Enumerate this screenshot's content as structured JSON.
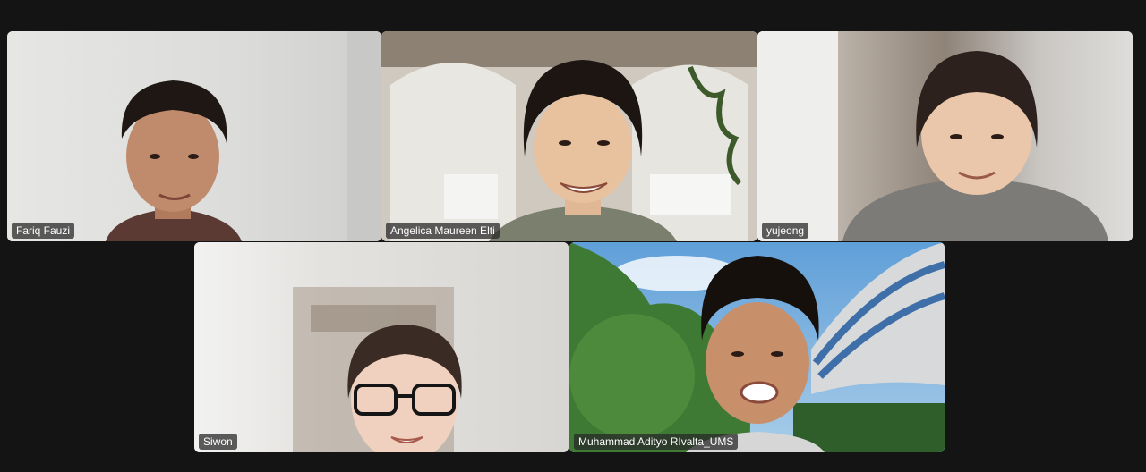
{
  "meeting": {
    "participants": [
      {
        "name": "Fariq Fauzi",
        "active": false
      },
      {
        "name": "Angelica Maureen Elti",
        "active": false
      },
      {
        "name": "yujeong",
        "active": false
      },
      {
        "name": "Siwon",
        "active": false
      },
      {
        "name": "Muhammad Adityo RIvalta_UMS",
        "active": true
      }
    ]
  },
  "colors": {
    "background": "#141414",
    "active_speaker_border": "#2ecc71",
    "label_bg": "#282828"
  }
}
